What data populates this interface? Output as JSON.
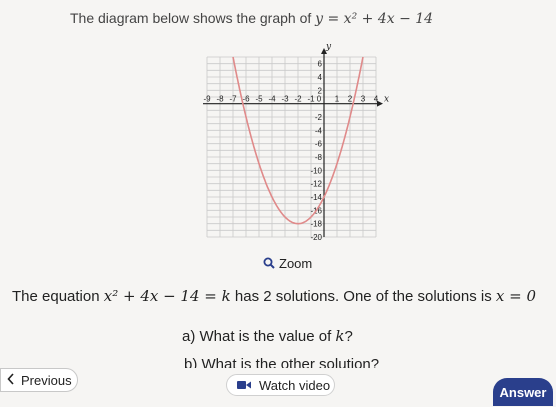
{
  "header": {
    "prefix": "The diagram below shows the graph of ",
    "equation": "y = x² + 4x − 14"
  },
  "graph": {
    "x_axis_label": "x",
    "y_axis_label": "y",
    "x_tick_labels": [
      "-9",
      "-8",
      "-7",
      "-6",
      "-5",
      "-4",
      "-3",
      "-2",
      "-1",
      "0",
      "1",
      "2",
      "3",
      "4"
    ],
    "y_tick_labels": [
      "6",
      "4",
      "2",
      "-2",
      "-4",
      "-6",
      "-8",
      "-10",
      "-12",
      "-14",
      "-16",
      "-18",
      "-20"
    ],
    "x_range": [
      -9,
      4
    ],
    "y_range": [
      -20,
      7
    ],
    "curve_color": "#e08a8a",
    "grid_color": "#c9c9c9"
  },
  "zoom": {
    "label": "Zoom"
  },
  "question": {
    "intro": "The equation ",
    "equation": "x² + 4x − 14 = k",
    "middle": " has 2 solutions. One of the solutions is ",
    "given_solution": "x = 0",
    "part_a_prefix": "a) What is the value of ",
    "part_a_var": "k",
    "part_a_suffix": "?",
    "part_b": "b) What is the other solution?"
  },
  "nav": {
    "previous_label": "Previous",
    "watch_label": "Watch video",
    "answer_label": "Answer"
  },
  "colors": {
    "answer_button": "#2a3f8c",
    "zoom_icon": "#2a3f8c"
  }
}
